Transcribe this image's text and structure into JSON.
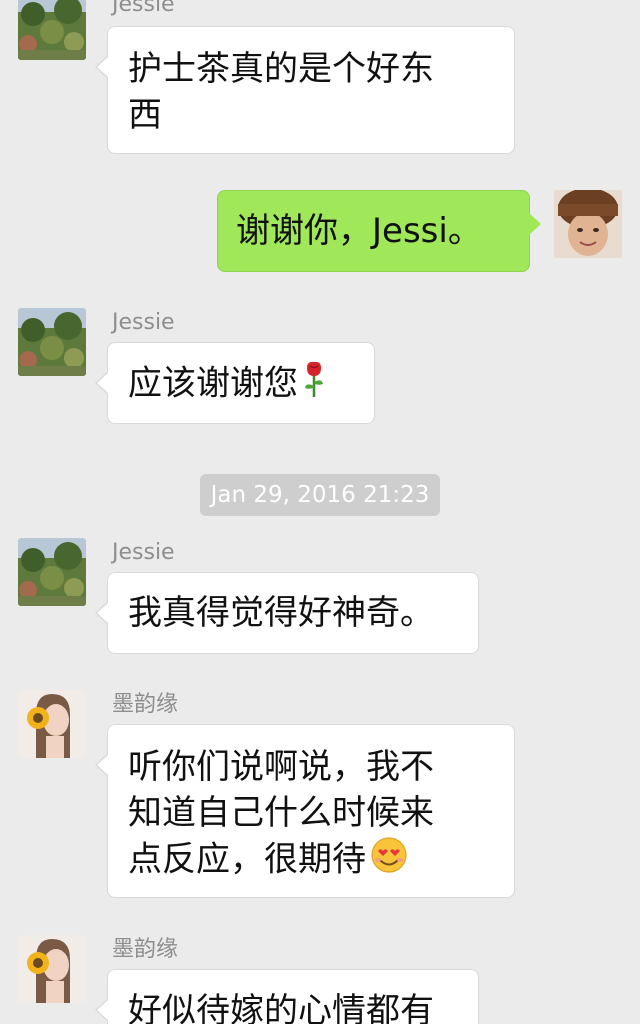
{
  "timestamp": "Jan 29, 2016 21:23",
  "messages": [
    {
      "sender": "Jessie",
      "text": "护士茶真的是个好东西",
      "lines": [
        "护士茶真的是个好东",
        "西"
      ],
      "direction": "incoming"
    },
    {
      "sender": "",
      "text": "谢谢你，Jessi。",
      "direction": "outgoing"
    },
    {
      "sender": "Jessie",
      "text": "应该谢谢您",
      "emoji": "rose-icon",
      "direction": "incoming"
    },
    {
      "sender": "Jessie",
      "text": "我真得觉得好神奇。",
      "direction": "incoming"
    },
    {
      "sender": "墨韵缘",
      "lines": [
        "听你们说啊说，我不",
        "知道自己什么时候来",
        "点反应，很期待"
      ],
      "emoji": "smiling-face-heart-eyes-icon",
      "direction": "incoming"
    },
    {
      "sender": "墨韵缘",
      "text": "好似待嫁的心情都有",
      "direction": "incoming"
    }
  ],
  "colors": {
    "background": "#ebebeb",
    "incoming_bubble": "#ffffff",
    "outgoing_bubble": "#a0e75a",
    "sender_name": "#8e8e8e",
    "timestamp_pill": "#cecece"
  }
}
